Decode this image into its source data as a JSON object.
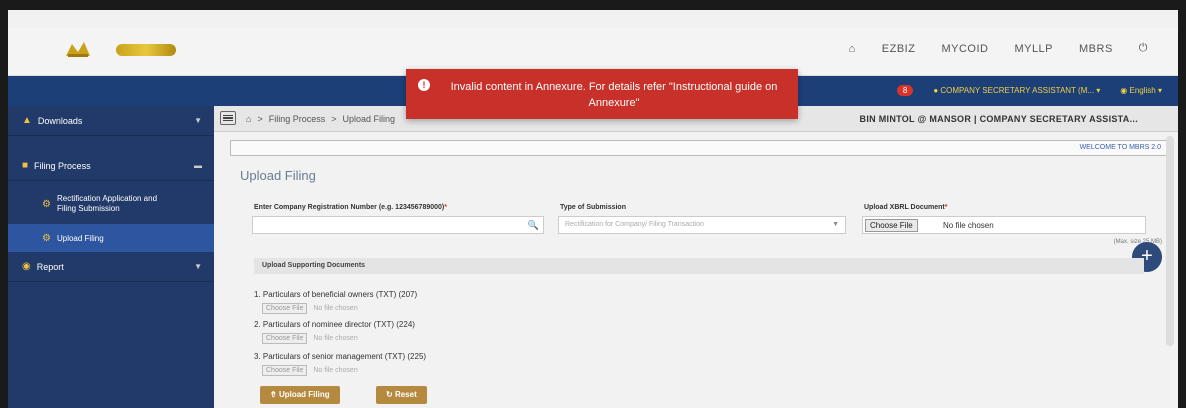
{
  "header": {
    "nav": [
      "EZBIZ",
      "MYCOID",
      "MYLLP",
      "MBRS"
    ],
    "icons": [
      "home-icon",
      "power-icon"
    ]
  },
  "navbar": {
    "notif_count": "8",
    "role": "COMPANY SECRETARY ASSISTANT (M...",
    "language": "English"
  },
  "alert": {
    "message": "Invalid content in Annexure. For details refer \"Instructional guide on Annexure\""
  },
  "sidebar": {
    "items": [
      {
        "label": "Downloads"
      },
      {
        "label": "Filing Process"
      },
      {
        "label": "Rectification Application and Filing Submission"
      },
      {
        "label": "Upload Filing"
      },
      {
        "label": "Report"
      }
    ]
  },
  "breadcrumb": [
    "Filing Process",
    "Upload Filing"
  ],
  "user_line": "BIN MINTOL @ MANSOR | COMPANY SECRETARY ASSISTA...",
  "welcome": "WELCOME TO MBRS 2.0",
  "page_title": "Upload Filing",
  "form": {
    "reg_label": "Enter Company Registration Number (e.g. 123456789000)",
    "submission_label": "Type of Submission",
    "submission_value": "Rectification for Company/ Filing Transaction",
    "xbrl_label": "Upload XBRL Document",
    "choose_file": "Choose File",
    "no_file": "No file chosen",
    "max_size": "(Max. size 25 MB)"
  },
  "supporting": {
    "header": "Upload Supporting Documents",
    "docs": [
      "1. Particulars of beneficial owners (TXT) (207)",
      "2. Particulars of nominee director (TXT) (224)",
      "3. Particulars of senior management (TXT) (225)"
    ],
    "choose_file": "Choose File",
    "no_file": "No file chosen"
  },
  "buttons": {
    "upload": "Upload Filing",
    "reset": "Reset"
  }
}
